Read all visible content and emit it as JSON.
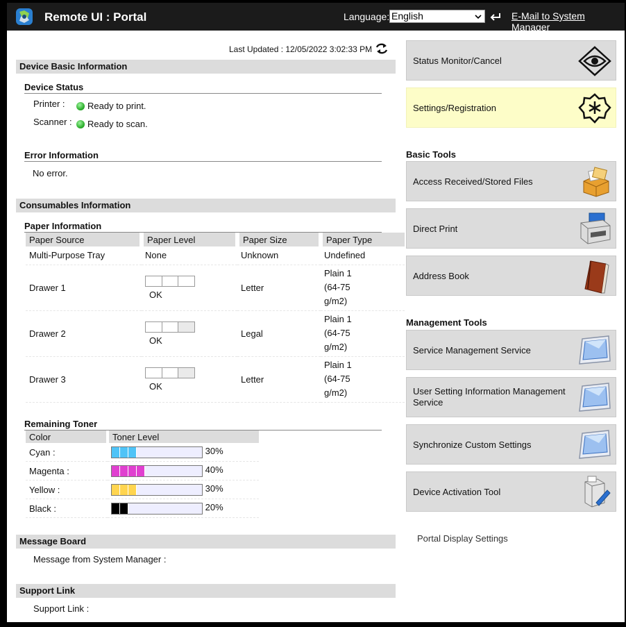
{
  "header": {
    "title": "Remote UI : Portal",
    "language_label": "Language:",
    "language_value": "English",
    "mail_link": "E-Mail to System Manager"
  },
  "last_updated": "Last Updated : 12/05/2022 3:02:33 PM",
  "device_basic": {
    "title": "Device Basic Information",
    "status_title": "Device Status",
    "printer_label": "Printer :",
    "printer_status": "Ready to print.",
    "scanner_label": "Scanner :",
    "scanner_status": "Ready to scan.",
    "error_title": "Error Information",
    "error_text": "No error."
  },
  "consumables": {
    "title": "Consumables Information",
    "paper_title": "Paper Information",
    "paper_columns": [
      "Paper Source",
      "Paper Level",
      "Paper Size",
      "Paper Type"
    ],
    "paper_rows": [
      {
        "source": "Multi-Purpose Tray",
        "level": "None",
        "segments": 0,
        "size": "Unknown",
        "type": [
          "Undefined"
        ]
      },
      {
        "source": "Drawer 1",
        "level": "OK",
        "segments": 3,
        "size": "Letter",
        "type": [
          "Plain 1",
          "(64-75",
          "g/m2)"
        ]
      },
      {
        "source": "Drawer 2",
        "level": "OK",
        "segments": 2,
        "size": "Legal",
        "type": [
          "Plain 1",
          "(64-75",
          "g/m2)"
        ]
      },
      {
        "source": "Drawer 3",
        "level": "OK",
        "segments": 2,
        "size": "Letter",
        "type": [
          "Plain 1",
          "(64-75",
          "g/m2)"
        ]
      }
    ],
    "toner_title": "Remaining Toner",
    "toner_columns": [
      "Color",
      "Toner Level"
    ],
    "toner_rows": [
      {
        "color": "Cyan :",
        "level": "30%",
        "fraction": 0.3,
        "hex": "#4fc3f7"
      },
      {
        "color": "Magenta :",
        "level": "40%",
        "fraction": 0.4,
        "hex": "#e040d0"
      },
      {
        "color": "Yellow :",
        "level": "30%",
        "fraction": 0.3,
        "hex": "#ffd54f"
      },
      {
        "color": "Black :",
        "level": "20%",
        "fraction": 0.2,
        "hex": "#000000"
      }
    ]
  },
  "message_board": {
    "title": "Message Board",
    "label": "Message from System Manager :"
  },
  "support": {
    "title": "Support Link",
    "label": "Support Link :"
  },
  "right_panel": {
    "status_monitor": "Status Monitor/Cancel",
    "settings": "Settings/Registration",
    "basic_tools_title": "Basic Tools",
    "access_files": "Access Received/Stored Files",
    "direct_print": "Direct Print",
    "address_book": "Address Book",
    "management_tools_title": "Management Tools",
    "service_mgmt": "Service Management Service",
    "user_setting_1": "User Setting Information Management",
    "user_setting_2": "Service",
    "sync_custom": "Synchronize Custom Settings",
    "device_activation": "Device Activation Tool",
    "portal_display": "Portal Display Settings"
  },
  "colors": {
    "highlight": "#fdfdc8",
    "section_bg": "#dcdcdc",
    "topbar": "#1b1b1b"
  }
}
